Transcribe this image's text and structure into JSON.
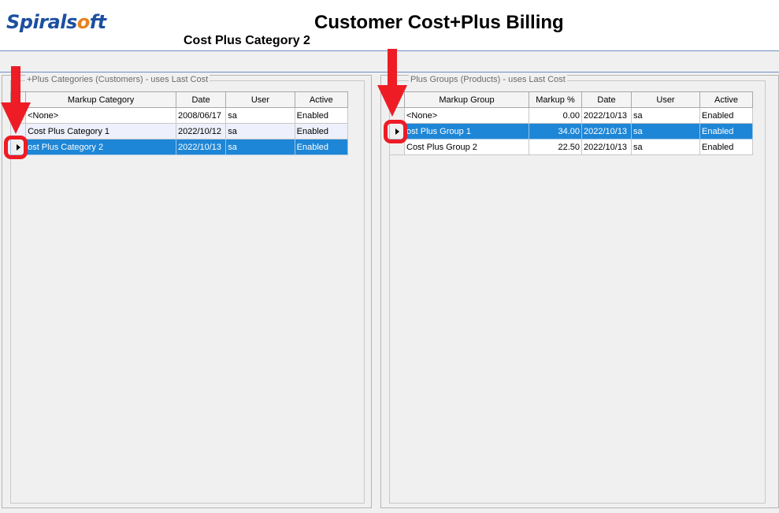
{
  "app": {
    "logo_main": "Spirals",
    "logo_o": "o",
    "logo_end": "ft",
    "title": "Customer Cost+Plus Billing",
    "subtitle": "Cost Plus Category 2"
  },
  "left": {
    "legend": "+Plus Categories (Customers)  -  uses Last Cost",
    "columns": [
      "Markup Category",
      "Date",
      "User",
      "Active"
    ],
    "rows": [
      {
        "name": "<None>",
        "date": "2008/06/17",
        "user": "sa",
        "active": "Enabled"
      },
      {
        "name": "Cost Plus Category 1",
        "date": "2022/10/12",
        "user": "sa",
        "active": "Enabled"
      },
      {
        "name": "ost Plus Category 2",
        "date": "2022/10/13",
        "user": "sa",
        "active": "Enabled"
      }
    ],
    "selected_row": 2
  },
  "right": {
    "legend": "Plus Groups (Products)  -  uses Last Cost",
    "columns": [
      "Markup Group",
      "Markup %",
      "Date",
      "User",
      "Active"
    ],
    "rows": [
      {
        "name": "<None>",
        "markup": "0.00",
        "date": "2022/10/13",
        "user": "sa",
        "active": "Enabled"
      },
      {
        "name": "ost Plus Group 1",
        "markup": "34.00",
        "date": "2022/10/13",
        "user": "sa",
        "active": "Enabled"
      },
      {
        "name": "Cost Plus Group 2",
        "markup": "22.50",
        "date": "2022/10/13",
        "user": "sa",
        "active": "Enabled"
      }
    ],
    "selected_row": 1
  },
  "colors": {
    "selection": "#1e86d6",
    "annotation": "#ee1c24",
    "logo_blue": "#1d4fa0",
    "logo_orange": "#e8821e"
  },
  "icons": [
    "row-indicator-icon",
    "annotation-arrow-icon"
  ]
}
